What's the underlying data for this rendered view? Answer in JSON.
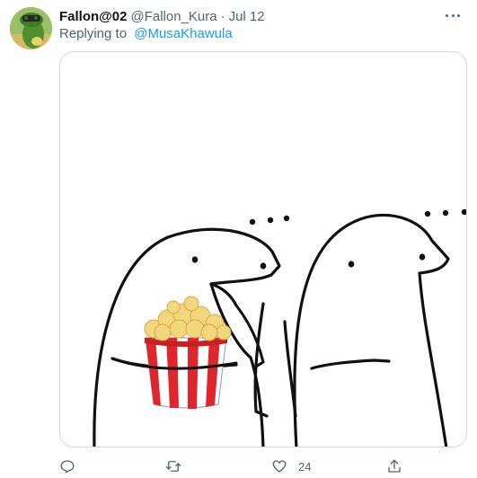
{
  "tweet": {
    "display_name": "Fallon@02",
    "handle": "@Fallon_Kura",
    "separator": "·",
    "timestamp": "Jul 12",
    "reply_prefix": "Replying to",
    "reply_to": "@MusaKhawula"
  },
  "media": {
    "type": "meme-image",
    "description_icon": "popcorn-icon"
  },
  "actions": {
    "reply_icon": "reply-icon",
    "retweet_icon": "retweet-icon",
    "like_icon": "like-icon",
    "like_count": "24",
    "share_icon": "share-icon"
  },
  "colors": {
    "accent": "#1d9bf0",
    "secondary_text": "#536471",
    "border": "#cfd9de"
  }
}
